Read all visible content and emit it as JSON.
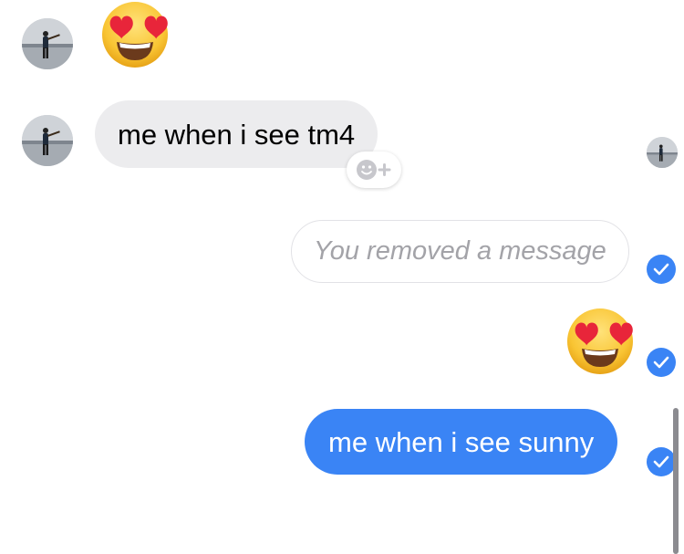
{
  "messages": {
    "incoming_text": "me when i see tm4",
    "removed_text": "You removed a message",
    "outgoing_text": "me when i see sunny"
  },
  "icons": {
    "avatar": "contact-avatar",
    "emoji": "heart-eyes-emoji",
    "reaction": "add-reaction-icon",
    "delivered": "delivered-check-icon"
  },
  "colors": {
    "outgoing_bubble": "#3a84f5",
    "incoming_bubble": "#ececee",
    "check": "#3a84f5",
    "removed_text": "#a3a3a8"
  }
}
